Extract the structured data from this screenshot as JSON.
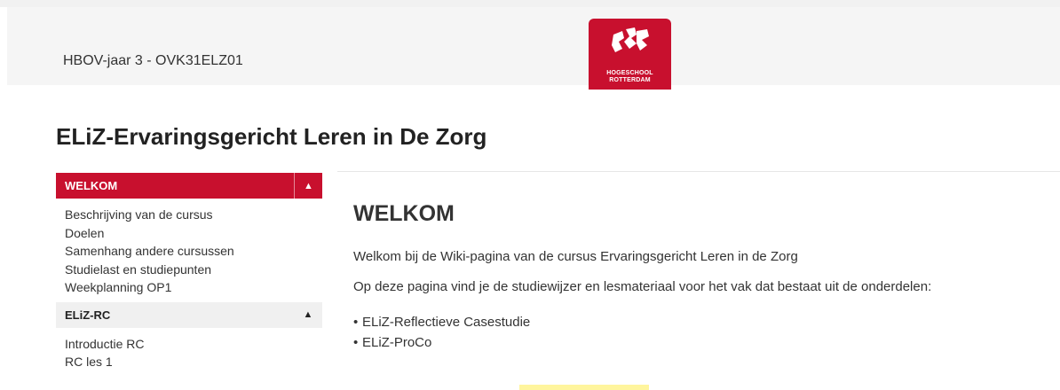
{
  "header": {
    "course_code": "HBOV-jaar 3 - OVK31ELZ01",
    "logo": {
      "line1": "HOGESCHOOL",
      "line2": "ROTTERDAM",
      "icon": "hogeschool-rotterdam-logo"
    }
  },
  "page": {
    "title": "ELiZ-Ervaringsgericht Leren in De Zorg"
  },
  "sidebar": {
    "sections": [
      {
        "label": "WELKOM",
        "toggle": "▲",
        "items": [
          "Beschrijving van de cursus",
          "Doelen",
          "Samenhang andere cursussen",
          "Studielast en studiepunten",
          "Weekplanning OP1"
        ]
      },
      {
        "label": "ELiZ-RC",
        "toggle": "▲",
        "items": [
          "Introductie RC",
          "RC les 1"
        ]
      }
    ]
  },
  "content": {
    "heading": "WELKOM",
    "paragraphs": [
      "Welkom bij de Wiki-pagina van de cursus Ervaringsgericht Leren in de Zorg",
      "Op deze pagina vind je de studiewijzer en lesmateriaal voor het vak dat bestaat uit de onderdelen:"
    ],
    "bullets": [
      "ELiZ-Reflectieve Casestudie",
      "ELiZ-ProCo"
    ]
  },
  "colors": {
    "brand": "#c8102e",
    "highlight": "#fff59d"
  }
}
